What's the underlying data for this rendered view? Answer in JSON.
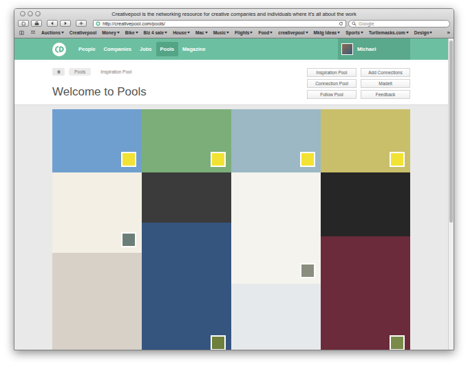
{
  "window": {
    "title": "Creativepool is the networking resource for creative companies and individuals where it’s all about the work"
  },
  "toolbar": {
    "url": "http://creativepool.com/pools/",
    "search": {
      "placeholder": "Google"
    }
  },
  "bookmarks": {
    "items": [
      {
        "label": "Auctions",
        "menu": true
      },
      {
        "label": "Creativepool",
        "menu": false
      },
      {
        "label": "Money",
        "menu": true
      },
      {
        "label": "Bike",
        "menu": true
      },
      {
        "label": "Biz 4 sale",
        "menu": true
      },
      {
        "label": "House",
        "menu": true
      },
      {
        "label": "Mac",
        "menu": true
      },
      {
        "label": "Music",
        "menu": true
      },
      {
        "label": "Flights",
        "menu": true
      },
      {
        "label": "Food",
        "menu": true
      },
      {
        "label": "creativepool",
        "menu": true
      },
      {
        "label": "Mktg Ideas",
        "menu": true
      },
      {
        "label": "Sports",
        "menu": true
      },
      {
        "label": "Turtlemasks.com",
        "menu": true
      },
      {
        "label": "Design",
        "menu": true
      }
    ],
    "more": "»"
  },
  "nav": {
    "items": [
      {
        "label": "People",
        "selected": false
      },
      {
        "label": "Companies",
        "selected": false
      },
      {
        "label": "Jobs",
        "selected": false
      },
      {
        "label": "Pools",
        "selected": true
      },
      {
        "label": "Magazine",
        "selected": false
      }
    ],
    "user": {
      "name": "Michael"
    }
  },
  "breadcrumb": [
    "Pools",
    "Inspiration Pool"
  ],
  "heading": "Welcome to Pools",
  "actions": [
    "Inspiration Pool",
    "Add Connections",
    "Connection Pool",
    "Madeit",
    "Follow Pool",
    "Feedback"
  ],
  "pool": {
    "banner": [
      {
        "color": "#6f9fcf",
        "badge": "#f2e233"
      },
      {
        "color": "#7cae7a",
        "badge": "#f2e233"
      },
      {
        "color": "#9bb8c4",
        "badge": "#f2e233"
      },
      {
        "color": "#c9bf6a",
        "badge": "#f2e233"
      }
    ],
    "columns": [
      [
        {
          "color": "#f3efe4",
          "badge": "#6b7f78"
        },
        {
          "color": "#d8d1c7",
          "badge": null
        }
      ],
      [
        {
          "color": "#3b3b3b",
          "badge": null
        },
        {
          "color": "#35557f",
          "badge": "#6f7f3c"
        }
      ],
      [
        {
          "color": "#f5f3ee",
          "badge": "#8a8e7e"
        },
        {
          "color": "#e6e9ec",
          "badge": null
        }
      ],
      [
        {
          "color": "#262626",
          "badge": null
        },
        {
          "color": "#6b2b3b",
          "badge": "#7a8a4a"
        }
      ]
    ]
  }
}
